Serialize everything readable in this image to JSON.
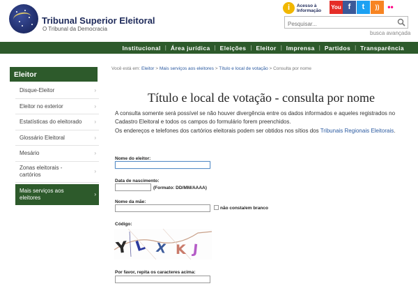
{
  "header": {
    "site_name": "Tribunal Superior Eleitoral",
    "site_subtitle": "O Tribunal da Democracia",
    "accessibility_line1": "Acesso à",
    "accessibility_line2": "Informação",
    "search_placeholder": "Pesquisar...",
    "advanced_search": "busca avançada",
    "social": [
      "youtube-icon",
      "facebook-icon",
      "twitter-icon",
      "rss-icon",
      "flickr-icon"
    ]
  },
  "nav": {
    "items": [
      "Institucional",
      "Área jurídica",
      "Eleições",
      "Eleitor",
      "Imprensa",
      "Partidos",
      "Transparência"
    ],
    "separator": "|"
  },
  "sidebar": {
    "title": "Eleitor",
    "items": [
      "Disque-Eleitor",
      "Eleitor no exterior",
      "Estatísticas do eleitorado",
      "Glossário Eleitoral",
      "Mesário",
      "Zonas eleitorais - cartórios",
      "Mais serviços aos eleitores"
    ]
  },
  "breadcrumb": {
    "prefix": "Você está em:",
    "links": [
      "Eleitor",
      "Mais serviços aos eleitores",
      "Título e local de votação"
    ],
    "sep": ">",
    "current": "Consulta por nome"
  },
  "page": {
    "title": "Título e local de votação - consulta por nome",
    "intro_1": "A consulta somente será possível se não houver divergência entre os dados informados e aqueles registrados no Cadastro Eleitoral e todos os campos do formulário forem preenchidos.",
    "intro_2": "Os endereços e telefones dos cartórios eleitorais podem ser obtidos nos sítios dos ",
    "intro_link": "Tribunais Regionais Eleitorais",
    "intro_end": "."
  },
  "form": {
    "name_label": "Nome do eleitor:",
    "name_value": "",
    "birth_label": "Data de nascimento:",
    "birth_value": "",
    "birth_hint": "(Formato: DD/MM/AAAA)",
    "mother_label": "Nome da mãe:",
    "mother_value": "",
    "mother_checkbox_label": "não consta/em branco",
    "captcha_label": "Código:",
    "captcha_text": [
      "Y",
      "L",
      "X",
      "K",
      "J"
    ],
    "repeat_label": "Por favor, repita os caracteres acima:",
    "repeat_value": ""
  },
  "colors": {
    "nav_green": "#2d5a2b",
    "link_blue": "#2b5aa0",
    "brand_navy": "#1e2a5a"
  }
}
